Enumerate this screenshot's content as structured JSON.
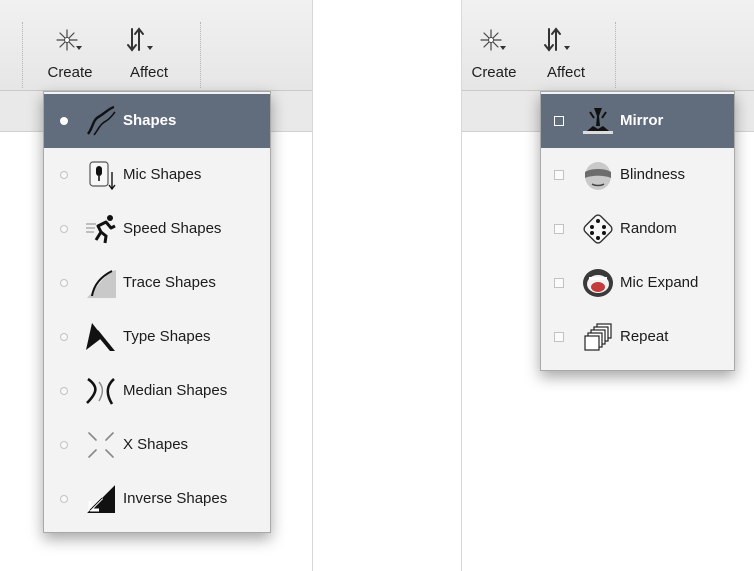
{
  "left_panel": {
    "toolbar": {
      "create_label": "Create",
      "affect_label": "Affect"
    },
    "create_menu": {
      "items": [
        {
          "label": "Shapes",
          "icon": "shapes-icon",
          "selected": true
        },
        {
          "label": "Mic Shapes",
          "icon": "mic-shapes-icon",
          "selected": false
        },
        {
          "label": "Speed Shapes",
          "icon": "speed-shapes-icon",
          "selected": false
        },
        {
          "label": "Trace Shapes",
          "icon": "trace-shapes-icon",
          "selected": false
        },
        {
          "label": "Type Shapes",
          "icon": "type-shapes-icon",
          "selected": false
        },
        {
          "label": "Median Shapes",
          "icon": "median-shapes-icon",
          "selected": false
        },
        {
          "label": "X Shapes",
          "icon": "x-shapes-icon",
          "selected": false
        },
        {
          "label": "Inverse Shapes",
          "icon": "inverse-shapes-icon",
          "selected": false
        }
      ]
    }
  },
  "right_panel": {
    "toolbar": {
      "create_label": "Create",
      "affect_label": "Affect"
    },
    "affect_menu": {
      "items": [
        {
          "label": "Mirror",
          "icon": "mirror-icon",
          "selected": true
        },
        {
          "label": "Blindness",
          "icon": "blindness-icon",
          "selected": false
        },
        {
          "label": "Random",
          "icon": "random-dice-icon",
          "selected": false
        },
        {
          "label": "Mic Expand",
          "icon": "mic-expand-icon",
          "selected": false
        },
        {
          "label": "Repeat",
          "icon": "repeat-icon",
          "selected": false
        }
      ]
    }
  },
  "colors": {
    "selection": "#616c7d",
    "menu_background": "#f3f3f3",
    "toolbar_background": "#ececec"
  }
}
